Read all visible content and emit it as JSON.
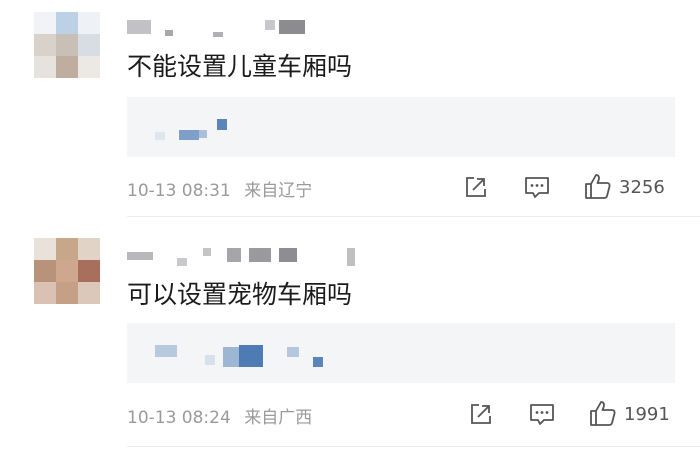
{
  "comments": [
    {
      "username": "",
      "text": "不能设置儿童车厢吗",
      "time": "10-13 08:31",
      "location": "来自辽宁",
      "likes": "3256",
      "actions": {
        "share_icon": "share-icon",
        "comment_icon": "comment-icon",
        "like_icon": "thumbs-up-icon"
      }
    },
    {
      "username": "",
      "text": "可以设置宠物车厢吗",
      "time": "10-13 08:24",
      "location": "来自广西",
      "likes": "1991",
      "actions": {
        "share_icon": "share-icon",
        "comment_icon": "comment-icon",
        "like_icon": "thumbs-up-icon"
      }
    }
  ],
  "colors": {
    "text": "#1b1b1b",
    "meta": "#9a9a9a",
    "quote_bg": "#f4f5f7",
    "mosaic_blue": "#5b84b8"
  }
}
